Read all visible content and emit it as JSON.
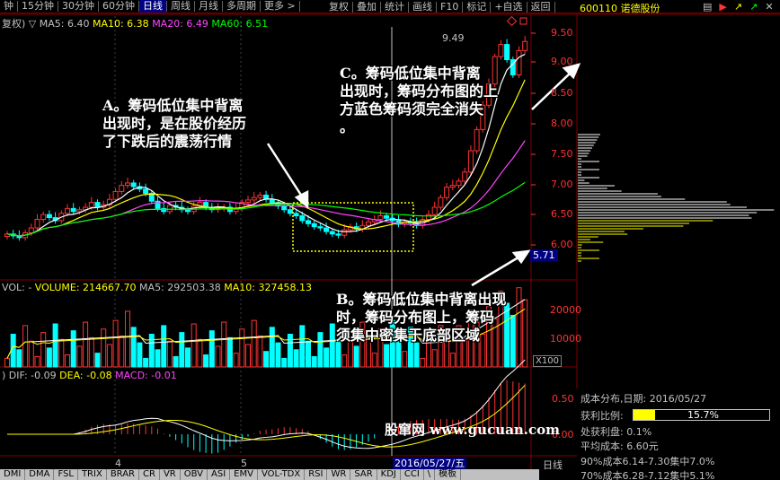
{
  "toolbar": {
    "items": [
      "钟",
      "15分钟",
      "30分钟",
      "60分钟",
      "日线",
      "周线",
      "月线",
      "多周期",
      "更多 >"
    ],
    "active_index": 4,
    "right_items": [
      "复权",
      "叠加",
      "统计",
      "画线",
      "F10",
      "标记",
      "+自选",
      "返回"
    ],
    "stock_name": "600110 诺德股份"
  },
  "price_panel": {
    "ma_line": {
      "prefix": "复权) ▽",
      "ma5": "MA5: 6.40",
      "ma10": "MA10: 6.38",
      "ma20": "MA20: 6.49",
      "ma60": "MA60: 6.51"
    },
    "axis_labels": [
      "9.50",
      "9.00",
      "8.50",
      "8.00",
      "7.50",
      "7.00",
      "6.50",
      "6.00"
    ],
    "peak_label": "9.49",
    "current_price_tag": "5.71"
  },
  "volume_panel": {
    "line": {
      "prefix": "VOL: -",
      "volume": "VOLUME: 214667.70",
      "ma5": "MA5: 292503.38",
      "ma10": "MA10: 327458.13"
    },
    "axis_labels": [
      "20000",
      "10000"
    ],
    "unit": "X100"
  },
  "macd_panel": {
    "line": {
      "prefix": ") ",
      "dif": "DIF: -0.09",
      "dea": "DEA: -0.08",
      "macd": "MACD: -0.01"
    },
    "axis_labels": [
      "0.50",
      "0.00"
    ]
  },
  "annotations": {
    "a": [
      "A。筹码低位集中背离",
      "出现时，是在股价经历",
      "了下跌后的震荡行情"
    ],
    "b": [
      "B。筹码低位集中背离出现",
      "时，筹码分布图上，筹码",
      "须集中密集于底部区域"
    ],
    "c": [
      "C。筹码低位集中背离",
      "出现时，筹码分布图的上",
      "方蓝色筹码须完全消失",
      "。"
    ]
  },
  "watermark": "股窜网 www.gucuan.com",
  "date_axis": {
    "label_1": "4",
    "label_2": "5",
    "cursor_date": "2016/05/27/五",
    "period": "日线"
  },
  "info_panel": {
    "title": "成本分布,日期: 2016/05/27",
    "profit_label": "获利比例:",
    "profit_value": "15.7%",
    "profit_ratio": 0.157,
    "avg_profit": "处获利盘: 0.1%",
    "avg_cost": "平均成本: 6.60元",
    "cost_90": "90%成本6.14-7.30集中7.0%",
    "cost_70": "70%成本6.28-7.12集中5.1%"
  },
  "tabs": {
    "items": [
      "DMI",
      "DMA",
      "FSL",
      "TRIX",
      "BRAR",
      "CR",
      "VR",
      "OBV",
      "ASI",
      "EMV",
      "VOL-TDX",
      "RSI",
      "WR",
      "SAR",
      "KDJ",
      "CCI",
      "\\",
      "模板"
    ],
    "active_index": -1
  },
  "colors": {
    "up": "#ff3333",
    "down": "#00ffff",
    "ma5": "#ffffff",
    "ma10": "#ffff00",
    "ma20": "#ff44ff",
    "ma60": "#00ff00"
  }
}
